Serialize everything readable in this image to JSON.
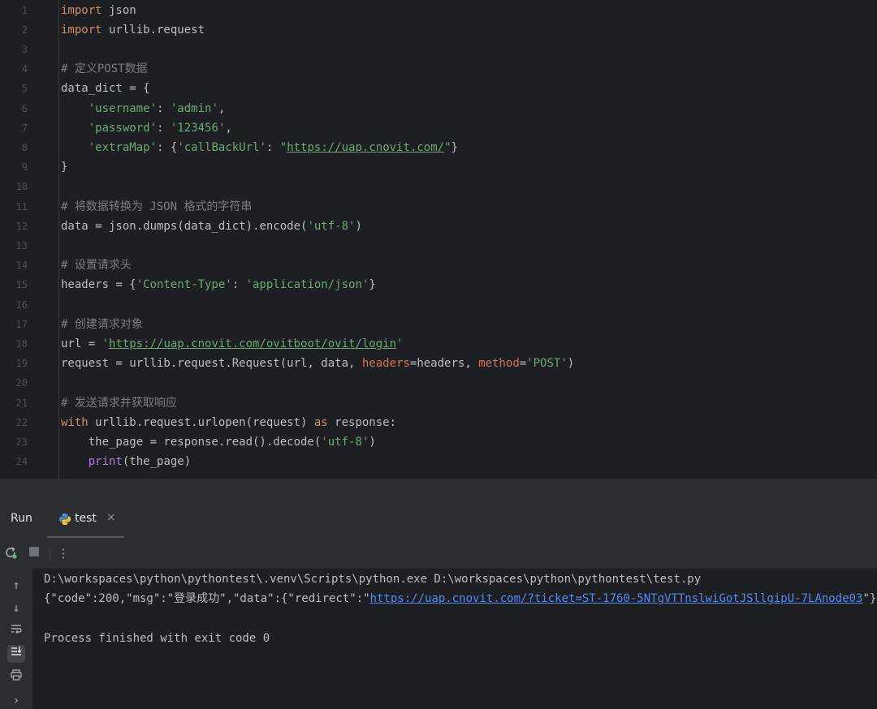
{
  "editor": {
    "line_numbers": [
      "1",
      "2",
      "3",
      "4",
      "5",
      "6",
      "7",
      "8",
      "9",
      "10",
      "11",
      "12",
      "13",
      "14",
      "15",
      "16",
      "17",
      "18",
      "19",
      "20",
      "21",
      "22",
      "23",
      "24"
    ],
    "lines": [
      [
        {
          "t": "import",
          "c": "kw"
        },
        {
          "t": " json"
        }
      ],
      [
        {
          "t": "import",
          "c": "kw"
        },
        {
          "t": " urllib.request"
        }
      ],
      [],
      [
        {
          "t": "# 定义POST数据",
          "c": "cmt"
        }
      ],
      [
        {
          "t": "data_dict = {"
        }
      ],
      [
        {
          "t": "    "
        },
        {
          "t": "'username'",
          "c": "str"
        },
        {
          "t": ": "
        },
        {
          "t": "'admin'",
          "c": "str"
        },
        {
          "t": ","
        }
      ],
      [
        {
          "t": "    "
        },
        {
          "t": "'password'",
          "c": "str"
        },
        {
          "t": ": "
        },
        {
          "t": "'123456'",
          "c": "str"
        },
        {
          "t": ","
        }
      ],
      [
        {
          "t": "    "
        },
        {
          "t": "'extraMap'",
          "c": "str"
        },
        {
          "t": ": {"
        },
        {
          "t": "'callBackUrl'",
          "c": "str"
        },
        {
          "t": ": "
        },
        {
          "t": "\"",
          "c": "str"
        },
        {
          "t": "https://uap.cnovit.com/",
          "c": "str url"
        },
        {
          "t": "\"",
          "c": "str"
        },
        {
          "t": "}"
        }
      ],
      [
        {
          "t": "}"
        }
      ],
      [],
      [
        {
          "t": "# 将数据转换为 JSON 格式的字符串",
          "c": "cmt"
        }
      ],
      [
        {
          "t": "data = json.dumps(data_dict).encode("
        },
        {
          "t": "'utf-8'",
          "c": "str"
        },
        {
          "t": ")"
        }
      ],
      [],
      [
        {
          "t": "# 设置请求头",
          "c": "cmt"
        }
      ],
      [
        {
          "t": "headers = {"
        },
        {
          "t": "'Content-Type'",
          "c": "str"
        },
        {
          "t": ": "
        },
        {
          "t": "'application/json'",
          "c": "str"
        },
        {
          "t": "}"
        }
      ],
      [],
      [
        {
          "t": "# 创建请求对象",
          "c": "cmt"
        }
      ],
      [
        {
          "t": "url = "
        },
        {
          "t": "'",
          "c": "str"
        },
        {
          "t": "https://uap.cnovit.com/ovitboot/ovit/login",
          "c": "str url"
        },
        {
          "t": "'",
          "c": "str"
        }
      ],
      [
        {
          "t": "request = urllib.request.Request(url, data, "
        },
        {
          "t": "headers",
          "c": "prm"
        },
        {
          "t": "=headers, "
        },
        {
          "t": "method",
          "c": "prm"
        },
        {
          "t": "="
        },
        {
          "t": "'POST'",
          "c": "str"
        },
        {
          "t": ")"
        }
      ],
      [],
      [
        {
          "t": "# 发送请求并获取响应",
          "c": "cmt"
        }
      ],
      [
        {
          "t": "with",
          "c": "kw"
        },
        {
          "t": " urllib.request.urlopen(request) "
        },
        {
          "t": "as",
          "c": "kw"
        },
        {
          "t": " response:"
        }
      ],
      [
        {
          "t": "    the_page = response.read().decode("
        },
        {
          "t": "'utf-8'",
          "c": "str"
        },
        {
          "t": ")"
        }
      ],
      [
        {
          "t": "    "
        },
        {
          "t": "print",
          "c": "bi"
        },
        {
          "t": "(the_page)"
        }
      ]
    ]
  },
  "run_panel": {
    "title": "Run",
    "tab_label": "test",
    "tab_close": "×",
    "toolbar": {
      "rerun_icon": "rerun-icon",
      "stop_icon": "stop-icon",
      "more_icon": "more-vertical-icon"
    },
    "sidebar_icons": [
      "arrow-up-icon",
      "arrow-down-icon",
      "soft-wrap-icon",
      "scroll-to-end-icon",
      "print-icon",
      "chevron-right-icon"
    ],
    "output": {
      "line1": "D:\\workspaces\\python\\pythontest\\.venv\\Scripts\\python.exe D:\\workspaces\\python\\pythontest\\test.py",
      "line2_prefix": "{\"code\":200,\"msg\":\"登录成功\",\"data\":{\"redirect\":\"",
      "line2_link": "https://uap.cnovit.com/?ticket=ST-1760-5NTgVTTnslwiGotJSllgipU-7LAnode03",
      "line2_suffix": "\"}}",
      "line4": "Process finished with exit code 0"
    }
  },
  "colors": {
    "editor_bg": "#1e1f22",
    "panel_bg": "#2b2d30",
    "keyword": "#cf8e6d",
    "string": "#6aab73",
    "comment": "#7a7e85",
    "param": "#d5715f",
    "builtin": "#b17be0",
    "link": "#548af7"
  }
}
